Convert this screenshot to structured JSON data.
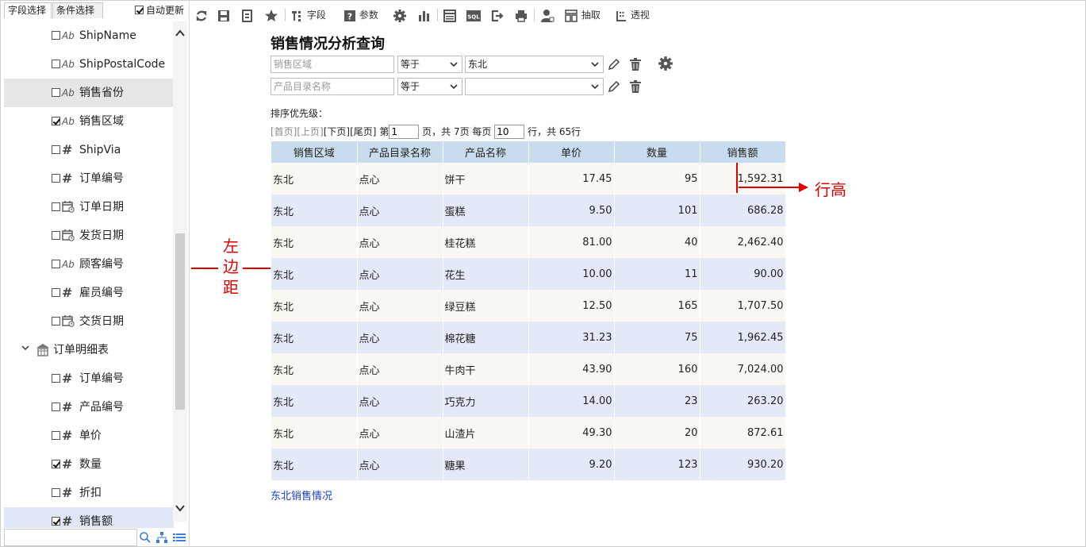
{
  "left_panel": {
    "tabs": [
      "字段选择",
      "条件选择"
    ],
    "auto_update": {
      "label": "自动更新",
      "checked": true
    },
    "fields": [
      {
        "label": "ShipName",
        "type": "text",
        "checked": false,
        "selected": false
      },
      {
        "label": "ShipPostalCode",
        "type": "text",
        "checked": false,
        "selected": false
      },
      {
        "label": "销售省份",
        "type": "text",
        "checked": false,
        "selected": true
      },
      {
        "label": "销售区域",
        "type": "text",
        "checked": true,
        "selected": false
      },
      {
        "label": "ShipVia",
        "type": "number",
        "checked": false,
        "selected": false
      },
      {
        "label": "订单编号",
        "type": "number",
        "checked": false,
        "selected": false
      },
      {
        "label": "订单日期",
        "type": "date",
        "checked": false,
        "selected": false
      },
      {
        "label": "发货日期",
        "type": "date",
        "checked": false,
        "selected": false
      },
      {
        "label": "顾客编号",
        "type": "text",
        "checked": false,
        "selected": false
      },
      {
        "label": "雇员编号",
        "type": "number",
        "checked": false,
        "selected": false
      },
      {
        "label": "交货日期",
        "type": "date",
        "checked": false,
        "selected": false
      },
      {
        "label": "订单明细表",
        "type": "group"
      },
      {
        "label": "订单编号",
        "type": "number",
        "checked": false,
        "selected": false
      },
      {
        "label": "产品编号",
        "type": "number",
        "checked": false,
        "selected": false
      },
      {
        "label": "单价",
        "type": "number",
        "checked": false,
        "selected": false
      },
      {
        "label": "数量",
        "type": "number",
        "checked": true,
        "selected": false
      },
      {
        "label": "折扣",
        "type": "number",
        "checked": false,
        "selected": false
      },
      {
        "label": "销售额",
        "type": "number",
        "checked": true,
        "selected": true
      }
    ],
    "search_placeholder": ""
  },
  "toolbar": {
    "field_label": "字段",
    "param_label": "参数",
    "extract_label": "抽取",
    "pivot_label": "透视"
  },
  "report": {
    "title": "销售情况分析查询",
    "conditions": [
      {
        "field_placeholder": "销售区域",
        "operator": "等于",
        "value": "东北"
      },
      {
        "field_placeholder": "产品目录名称",
        "operator": "等于",
        "value": ""
      }
    ],
    "sort_label": "排序优先级：",
    "pager": {
      "first": "[首页]",
      "prev": "[上页]",
      "next": "[下页]",
      "last": "[尾页]",
      "page_prefix": "第",
      "page": "1",
      "page_suffix": "页，共 7页 每页",
      "page_size": "10",
      "size_suffix": "行，共 65行"
    },
    "columns": [
      "销售区域",
      "产品目录名称",
      "产品名称",
      "单价",
      "数量",
      "销售额"
    ],
    "rows": [
      [
        "东北",
        "点心",
        "饼干",
        "17.45",
        "95",
        "1,592.31"
      ],
      [
        "东北",
        "点心",
        "蛋糕",
        "9.50",
        "101",
        "686.28"
      ],
      [
        "东北",
        "点心",
        "桂花糕",
        "81.00",
        "40",
        "2,462.40"
      ],
      [
        "东北",
        "点心",
        "花生",
        "10.00",
        "11",
        "90.00"
      ],
      [
        "东北",
        "点心",
        "绿豆糕",
        "12.50",
        "165",
        "1,707.50"
      ],
      [
        "东北",
        "点心",
        "棉花糖",
        "31.23",
        "75",
        "1,962.45"
      ],
      [
        "东北",
        "点心",
        "牛肉干",
        "43.90",
        "160",
        "7,024.00"
      ],
      [
        "东北",
        "点心",
        "巧克力",
        "14.00",
        "23",
        "263.20"
      ],
      [
        "东北",
        "点心",
        "山渣片",
        "49.30",
        "20",
        "872.61"
      ],
      [
        "东北",
        "点心",
        "糖果",
        "9.20",
        "123",
        "930.20"
      ]
    ],
    "footer_link": "东北销售情况"
  },
  "annotations": {
    "left_margin": [
      "左",
      "边",
      "距"
    ],
    "row_height": "行高"
  },
  "colors": {
    "header_bg": "#c9dbee",
    "row_odd": "#f8f7f2",
    "row_even": "#e4e9f8",
    "annotation": "#e00000",
    "link": "#1a3fbf"
  }
}
